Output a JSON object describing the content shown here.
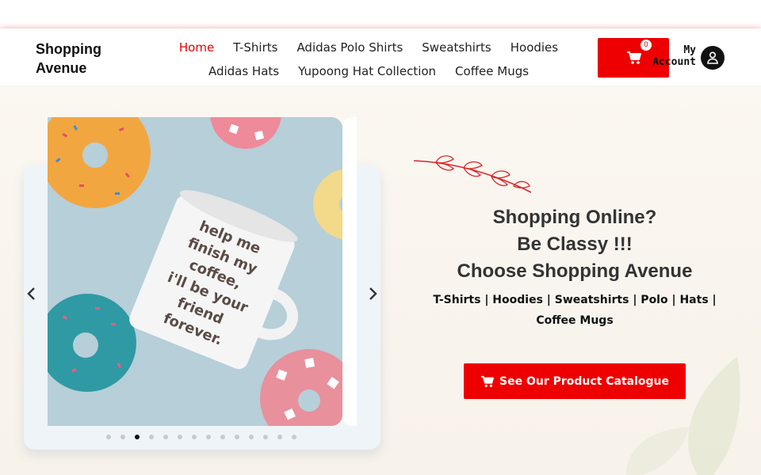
{
  "brand": {
    "name": "Shopping Avenue"
  },
  "nav": {
    "row1": [
      {
        "label": "Home",
        "active": true
      },
      {
        "label": "T-Shirts"
      },
      {
        "label": "Adidas Polo Shirts"
      },
      {
        "label": "Sweatshirts"
      },
      {
        "label": "Hoodies"
      }
    ],
    "row2": [
      {
        "label": "Adidas Hats"
      },
      {
        "label": "Yupoong Hat Collection"
      },
      {
        "label": "Coffee Mugs"
      }
    ]
  },
  "cart": {
    "count": "0",
    "icon": "cart-icon"
  },
  "account": {
    "label_line1": "My",
    "label_line2": "Account",
    "icon": "user-icon"
  },
  "hero": {
    "slider": {
      "mug_text": [
        "help me",
        "finish my",
        "coffee,",
        "i'll be your",
        "friend",
        "forever."
      ],
      "dot_count": 14,
      "active_dot": 2
    },
    "headline": [
      "Shopping Online?",
      "Be Classy !!!",
      "Choose Shopping Avenue"
    ],
    "subline": "T-Shirts | Hoodies | Sweatshirts | Polo | Hats | Coffee Mugs",
    "cta_label": "See Our Product Catalogue"
  },
  "colors": {
    "accent": "#ee0000",
    "active_nav": "#e60000",
    "text": "#222222"
  }
}
